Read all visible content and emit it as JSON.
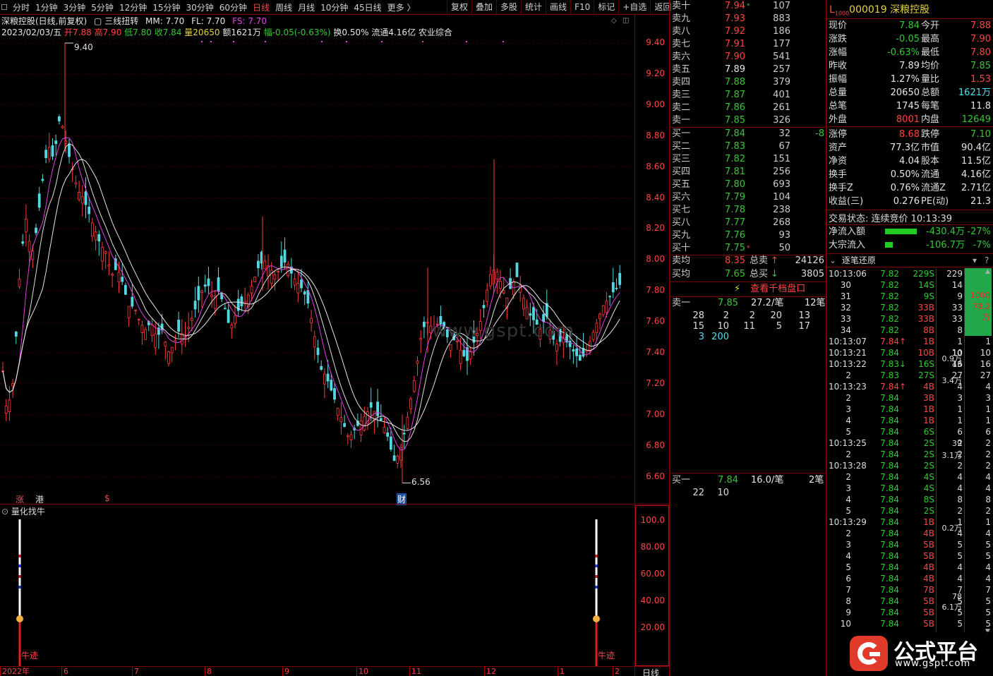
{
  "toolbar": {
    "timeframes": [
      "分时",
      "1分钟",
      "3分钟",
      "5分钟",
      "12分钟",
      "15分钟",
      "30分钟",
      "60分钟",
      "日线",
      "周线",
      "月线",
      "10分钟",
      "45日线",
      "更多 〉"
    ],
    "active_index": 8,
    "right_buttons": [
      "复权",
      "叠加",
      "多股",
      "统计",
      "画线",
      "F10",
      "标记",
      "+自选",
      "返回"
    ]
  },
  "chart_header": {
    "stock_name": "深粮控股(日线,前复权)",
    "indicator": "三线扭转",
    "mm": "MM: 7.70",
    "fl": "FL: 7.70",
    "fs": "FS: 7.70",
    "date": "2023/02/03/五",
    "open": "开7.88",
    "high": "高7.90",
    "low": "低7.80",
    "close": "收7.84",
    "volume": "量20650",
    "amount": "额1621万",
    "change": "幅-0.05(-0.63%)",
    "turnover": "换0.50%",
    "float_cap": "流通4.16亿",
    "sector": "农业综合"
  },
  "main_chart": {
    "price_ticks": [
      "9.40",
      "9.20",
      "9.00",
      "8.80",
      "8.60",
      "8.40",
      "8.20",
      "8.00",
      "7.80",
      "7.60",
      "7.40",
      "7.20",
      "7.00",
      "6.80",
      "6.60"
    ],
    "high_label": "9.40",
    "low_label": "6.56",
    "watermark": "www.gspt.com",
    "markers": [
      "涨",
      "港",
      "$",
      "财"
    ]
  },
  "sub_chart": {
    "title": "量化找牛",
    "ticks": [
      "100.0",
      "80.00",
      "60.00",
      "40.00",
      "20.00"
    ],
    "signal_label": "牛迹"
  },
  "x_axis": {
    "labels": [
      "2022年",
      "6",
      "7",
      "8",
      "9",
      "10",
      "11",
      "12",
      "1",
      "2"
    ],
    "period": "日线"
  },
  "order_book": {
    "sell": [
      {
        "label": "卖十",
        "price": "7.94",
        "vol": "107",
        "flag": "*"
      },
      {
        "label": "卖九",
        "price": "7.93",
        "vol": "883"
      },
      {
        "label": "卖八",
        "price": "7.92",
        "vol": "186"
      },
      {
        "label": "卖七",
        "price": "7.91",
        "vol": "177"
      },
      {
        "label": "卖六",
        "price": "7.90",
        "vol": "541"
      },
      {
        "label": "卖五",
        "price": "7.89",
        "vol": "257"
      },
      {
        "label": "卖四",
        "price": "7.88",
        "vol": "379"
      },
      {
        "label": "卖三",
        "price": "7.87",
        "vol": "401"
      },
      {
        "label": "卖二",
        "price": "7.86",
        "vol": "261"
      },
      {
        "label": "卖一",
        "price": "7.85",
        "vol": "326"
      }
    ],
    "buy": [
      {
        "label": "买一",
        "price": "7.84",
        "vol": "32",
        "delta": "-8"
      },
      {
        "label": "买二",
        "price": "7.83",
        "vol": "67"
      },
      {
        "label": "买三",
        "price": "7.82",
        "vol": "151"
      },
      {
        "label": "买四",
        "price": "7.81",
        "vol": "256"
      },
      {
        "label": "买五",
        "price": "7.80",
        "vol": "693"
      },
      {
        "label": "买六",
        "price": "7.79",
        "vol": "104"
      },
      {
        "label": "买七",
        "price": "7.78",
        "vol": "238"
      },
      {
        "label": "买八",
        "price": "7.77",
        "vol": "268"
      },
      {
        "label": "买九",
        "price": "7.76",
        "vol": "93"
      },
      {
        "label": "买十",
        "price": "7.75",
        "vol": "50",
        "flag": "*"
      }
    ],
    "sell_avg_label": "卖均",
    "sell_avg": "8.35",
    "total_sell_label": "总卖",
    "total_sell": "24126",
    "buy_avg_label": "买均",
    "buy_avg": "7.65",
    "total_buy_label": "总买",
    "total_buy": "3805",
    "thousand_button": "查看千档盘口",
    "queue_sell": {
      "label": "卖一",
      "price": "7.85",
      "per": "27.2/笔",
      "count": "12笔",
      "orders": [
        "28",
        "2",
        "2",
        "20",
        "13",
        "15",
        "10",
        "11",
        "5",
        "17",
        "3",
        "200"
      ]
    },
    "queue_buy": {
      "label": "买一",
      "price": "7.84",
      "per": "16.0/笔",
      "count": "2笔",
      "orders": [
        "22",
        "10"
      ]
    }
  },
  "quote": {
    "header_prefix": "L",
    "header_sub": "1000",
    "code_name": "000019 深粮控股",
    "rows": [
      [
        "现价",
        "7.84",
        "今开",
        "7.88"
      ],
      [
        "涨跌",
        "-0.05",
        "最高",
        "7.90"
      ],
      [
        "涨幅",
        "-0.63%",
        "最低",
        "7.80"
      ],
      [
        "昨收",
        "7.89",
        "均价",
        "7.85"
      ],
      [
        "振幅",
        "1.27%",
        "量比",
        "1.53"
      ],
      [
        "总量",
        "20650",
        "总额",
        "1621万"
      ],
      [
        "总笔",
        "1745",
        "每笔",
        "11.8"
      ],
      [
        "外盘",
        "8001",
        "内盘",
        "12649"
      ],
      [
        "涨停",
        "8.68",
        "跌停",
        "7.10"
      ],
      [
        "资产",
        "77.3亿",
        "市值",
        "90.4亿"
      ],
      [
        "净资",
        "4.04",
        "股本",
        "11.5亿"
      ],
      [
        "换手",
        "0.50%",
        "流通",
        "4.16亿"
      ],
      [
        "换手Z",
        "0.76%",
        "流通Z",
        "2.71亿"
      ],
      [
        "收益(三)",
        "0.276",
        "PE(动)",
        "21.3"
      ]
    ],
    "trade_status": "交易状态: 连续竞价 10:13:39",
    "net_inflow_label": "净流入额",
    "net_inflow": "-430.4万",
    "net_inflow_pct": "-27%",
    "block_inflow_label": "大宗流入",
    "block_inflow": "-106.7万",
    "block_inflow_pct": "-7%"
  },
  "ticks": {
    "title": "逐笔还原",
    "rows": [
      [
        "10:13:06",
        "7.82",
        "229S",
        "229"
      ],
      [
        "30",
        "7.82",
        "14S",
        "14"
      ],
      [
        "31",
        "7.82",
        "9S",
        "9"
      ],
      [
        "32",
        "7.82",
        "33B",
        "33"
      ],
      [
        "33",
        "7.82",
        "33B",
        "33"
      ],
      [
        "34",
        "7.82",
        "8B",
        "8"
      ],
      [
        "10:13:07",
        "7.84",
        "1B",
        "1"
      ],
      [
        "10:13:21",
        "7.84",
        "10B",
        "10"
      ],
      [
        "10:13:22",
        "7.83",
        "16S",
        "16"
      ],
      [
        "2",
        "7.83",
        "27S",
        "27"
      ],
      [
        "10:13:23",
        "7.84",
        "4B",
        "4"
      ],
      [
        "2",
        "7.84",
        "3B",
        "3"
      ],
      [
        "3",
        "7.84",
        "1B",
        "1"
      ],
      [
        "4",
        "7.84",
        "1B",
        "1"
      ],
      [
        "5",
        "7.84",
        "6S",
        "6"
      ],
      [
        "10:13:25",
        "7.84",
        "2S",
        "2"
      ],
      [
        "2",
        "7.84",
        "2S",
        "2"
      ],
      [
        "10:13:28",
        "7.84",
        "2S",
        "2"
      ],
      [
        "2",
        "7.84",
        "4S",
        "4"
      ],
      [
        "3",
        "7.84",
        "4S",
        "4"
      ],
      [
        "4",
        "7.84",
        "8S",
        "8"
      ],
      [
        "5",
        "7.84",
        "2S",
        "2"
      ],
      [
        "10:13:29",
        "7.84",
        "1B",
        "1"
      ],
      [
        "2",
        "7.84",
        "4B",
        "4"
      ],
      [
        "3",
        "7.84",
        "5B",
        "5"
      ],
      [
        "4",
        "7.84",
        "5B",
        "5"
      ],
      [
        "5",
        "7.84",
        "4B",
        "4"
      ],
      [
        "6",
        "7.84",
        "4B",
        "4"
      ],
      [
        "7",
        "7.84",
        "7B",
        "7"
      ],
      [
        "8",
        "7.84",
        "5B",
        "5"
      ],
      [
        "9",
        "7.84",
        "5B",
        "5"
      ],
      [
        "10",
        "7.84",
        "5B",
        "5"
      ]
    ],
    "groups": [
      {
        "top": "1000",
        "bot": "78.2万"
      },
      {
        "top": "10",
        "bot": "0.9万"
      },
      {
        "top": "43",
        "bot": "3.4万"
      },
      {
        "top": "39",
        "bot": "3.1万"
      },
      {
        "top": "",
        "bot": "0.2万"
      },
      {
        "top": "78",
        "bot": "6.1万"
      }
    ]
  },
  "logo": {
    "text": "公式平台",
    "url": "www.gspt.com"
  }
}
